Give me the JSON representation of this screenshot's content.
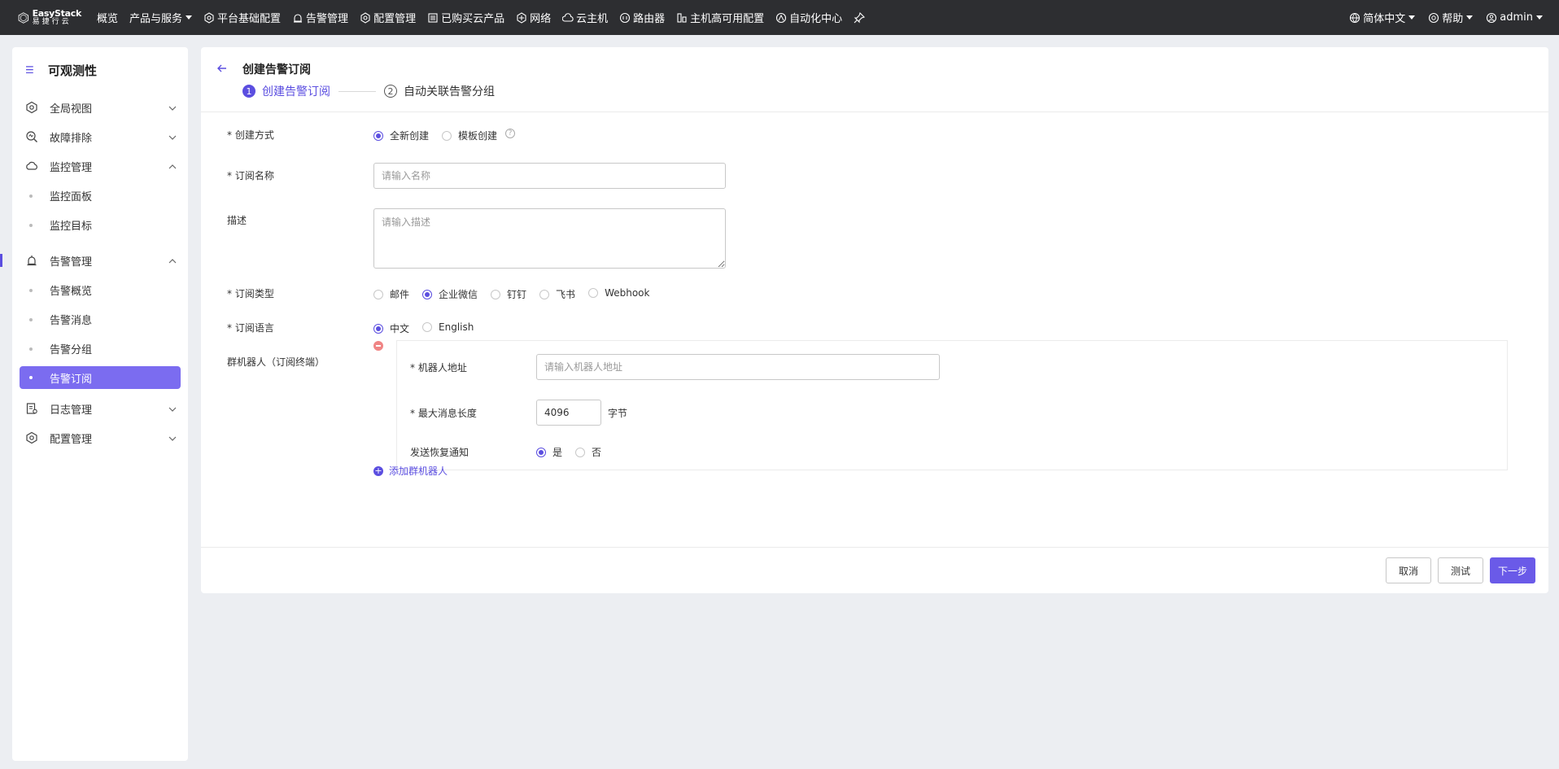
{
  "topbar": {
    "logo": {
      "line1": "EasyStack",
      "line2": "易捷行云"
    },
    "nav": [
      {
        "label": "概览",
        "icon": "",
        "caret": false
      },
      {
        "label": "产品与服务",
        "icon": "",
        "caret": true
      },
      {
        "label": "平台基础配置",
        "icon": "gear-icon",
        "caret": false
      },
      {
        "label": "告警管理",
        "icon": "alarm-icon",
        "caret": false
      },
      {
        "label": "配置管理",
        "icon": "gear-icon",
        "caret": false
      },
      {
        "label": "已购买云产品",
        "icon": "list-icon",
        "caret": false
      },
      {
        "label": "网络",
        "icon": "network-icon",
        "caret": false
      },
      {
        "label": "云主机",
        "icon": "cloud-icon",
        "caret": false
      },
      {
        "label": "路由器",
        "icon": "router-icon",
        "caret": false
      },
      {
        "label": "主机高可用配置",
        "icon": "ha-icon",
        "caret": false
      },
      {
        "label": "自动化中心",
        "icon": "automation-icon",
        "caret": false
      }
    ],
    "language": "简体中文",
    "help": "帮助",
    "user": "admin"
  },
  "sidebar": {
    "title": "可观测性",
    "items": [
      {
        "label": "全局视图"
      },
      {
        "label": "故障排除"
      },
      {
        "label": "监控管理",
        "children": [
          "监控面板",
          "监控目标"
        ]
      },
      {
        "label": "告警管理",
        "children": [
          "告警概览",
          "告警消息",
          "告警分组",
          "告警订阅"
        ]
      },
      {
        "label": "日志管理"
      },
      {
        "label": "配置管理"
      }
    ]
  },
  "page": {
    "title": "创建告警订阅",
    "steps": [
      {
        "num": "1",
        "label": "创建告警订阅"
      },
      {
        "num": "2",
        "label": "自动关联告警分组"
      }
    ]
  },
  "form": {
    "create_method": {
      "label": "* 创建方式",
      "options": [
        "全新创建",
        "模板创建"
      ],
      "selected": "全新创建"
    },
    "name": {
      "label": "* 订阅名称",
      "placeholder": "请输入名称",
      "value": ""
    },
    "description": {
      "label": "描述",
      "placeholder": "请输入描述",
      "value": ""
    },
    "sub_type": {
      "label": "* 订阅类型",
      "options": [
        "邮件",
        "企业微信",
        "钉钉",
        "飞书",
        "Webhook"
      ],
      "selected": "企业微信"
    },
    "language": {
      "label": "* 订阅语言",
      "options": [
        "中文",
        "English"
      ],
      "selected": "中文"
    },
    "robot": {
      "label": "群机器人（订阅终端）",
      "address": {
        "label": "* 机器人地址",
        "placeholder": "请输入机器人地址",
        "value": ""
      },
      "max_len": {
        "label": "* 最大消息长度",
        "value": "4096",
        "unit": "字节"
      },
      "recovery": {
        "label": "发送恢复通知",
        "options": [
          "是",
          "否"
        ],
        "selected": "是"
      }
    },
    "add_robot": "添加群机器人"
  },
  "footer": {
    "cancel": "取消",
    "test": "测试",
    "next": "下一步"
  },
  "colors": {
    "accent": "#5b4ee0",
    "topbar": "#2d2e31",
    "background": "#eceef2"
  }
}
